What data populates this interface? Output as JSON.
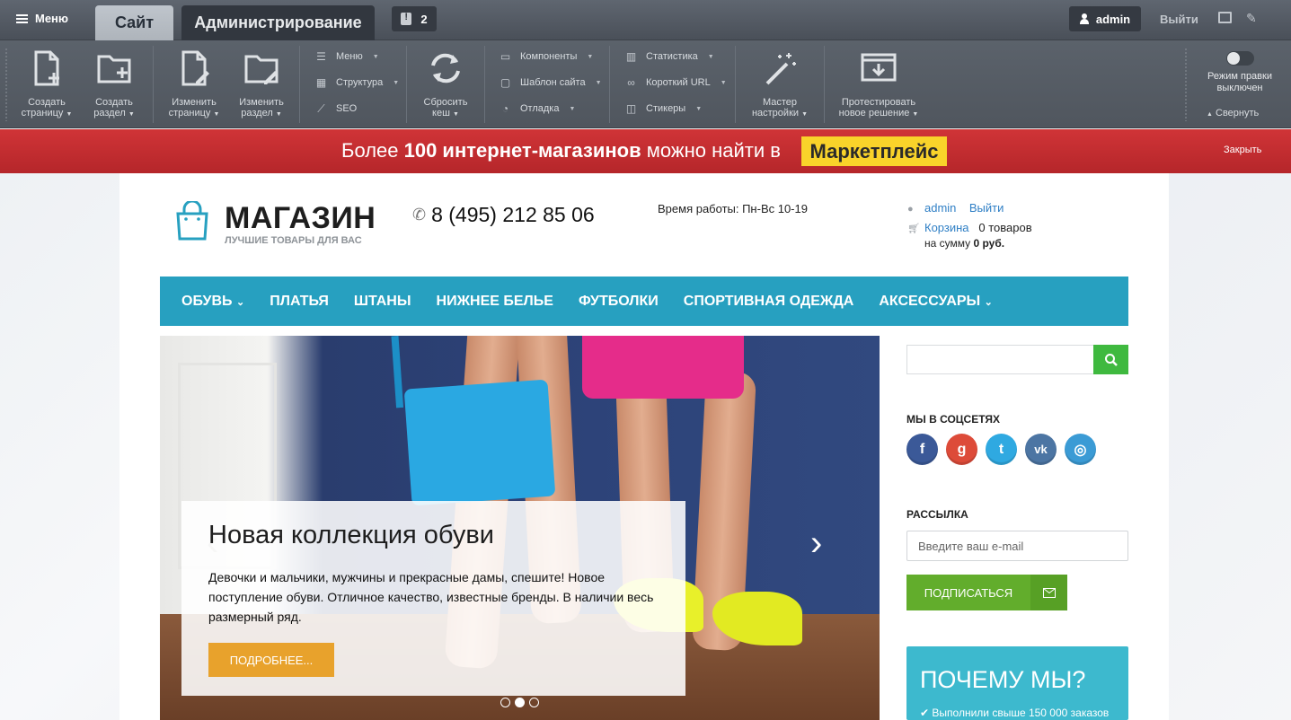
{
  "admin_bar": {
    "menu_label": "Меню",
    "tab_site": "Сайт",
    "tab_admin": "Администрирование",
    "notifications_count": "2",
    "user": "admin",
    "logout": "Выйти"
  },
  "toolbar": {
    "create_page": [
      "Создать",
      "страницу"
    ],
    "create_section": [
      "Создать",
      "раздел"
    ],
    "edit_page": [
      "Изменить",
      "страницу"
    ],
    "edit_section": [
      "Изменить",
      "раздел"
    ],
    "menu": "Меню",
    "structure": "Структура",
    "seo": "SEO",
    "reset_cache": [
      "Сбросить",
      "кеш"
    ],
    "components": "Компоненты",
    "site_template": "Шаблон сайта",
    "debug": "Отладка",
    "statistics": "Статистика",
    "short_url": "Короткий URL",
    "stickers": "Стикеры",
    "wizard": [
      "Мастер",
      "настройки"
    ],
    "test_solution": [
      "Протестировать",
      "новое решение"
    ],
    "edit_mode": [
      "Режим правки",
      "выключен"
    ],
    "collapse": "Свернуть"
  },
  "banner": {
    "text_before": "Более ",
    "text_bold": "100 интернет-магазинов",
    "text_after": " можно найти в",
    "badge": "Маркетплейс",
    "close": "Закрыть"
  },
  "header": {
    "logo_name": "МАГАЗИН",
    "logo_tagline": "ЛУЧШИЕ ТОВАРЫ ДЛЯ ВАС",
    "phone": "8 (495) 212 85 06",
    "hours": "Время работы: Пн-Вс 10-19",
    "user": "admin",
    "logout": "Выйти",
    "cart_label": "Корзина",
    "cart_count": "0 товаров",
    "sum_label": "на сумму ",
    "sum_value": "0 руб."
  },
  "nav": {
    "items": [
      "ОБУВЬ",
      "ПЛАТЬЯ",
      "ШТАНЫ",
      "НИЖНЕЕ БЕЛЬЕ",
      "ФУТБОЛКИ",
      "СПОРТИВНАЯ ОДЕЖДА",
      "АКСЕССУАРЫ"
    ]
  },
  "slider": {
    "title": "Новая коллекция обуви",
    "text": "Девочки и мальчики, мужчины и прекрасные дамы, спешите! Новое поступление обуви. Отличное качество, известные бренды. В наличии весь размерный ряд.",
    "button": "ПОДРОБНЕЕ...",
    "active_slide": 2,
    "slide_count": 3
  },
  "sidebar": {
    "social_title": "МЫ В СОЦСЕТЯХ",
    "socials": [
      {
        "name": "facebook",
        "glyph": "f",
        "color": "#3b5998"
      },
      {
        "name": "google-plus",
        "glyph": "g",
        "color": "#dd4b39"
      },
      {
        "name": "twitter",
        "glyph": "t",
        "color": "#2fa9e1"
      },
      {
        "name": "vk",
        "glyph": "vk",
        "color": "#4c75a3"
      },
      {
        "name": "instagram",
        "glyph": "◎",
        "color": "#3b9bd5"
      }
    ],
    "newsletter_title": "РАССЫЛКА",
    "email_placeholder": "Введите ваш e-mail",
    "subscribe": "ПОДПИСАТЬСЯ",
    "why_title": "ПОЧЕМУ МЫ?",
    "why_item": "Выполнили свыше 150 000 заказов"
  },
  "colors": {
    "accent": "#27a0c0",
    "banner_red": "#c42e31",
    "badge_yellow": "#f9d32a",
    "button_orange": "#e8a22c",
    "subscribe_green": "#62ad2c",
    "search_green": "#3fb93f"
  }
}
